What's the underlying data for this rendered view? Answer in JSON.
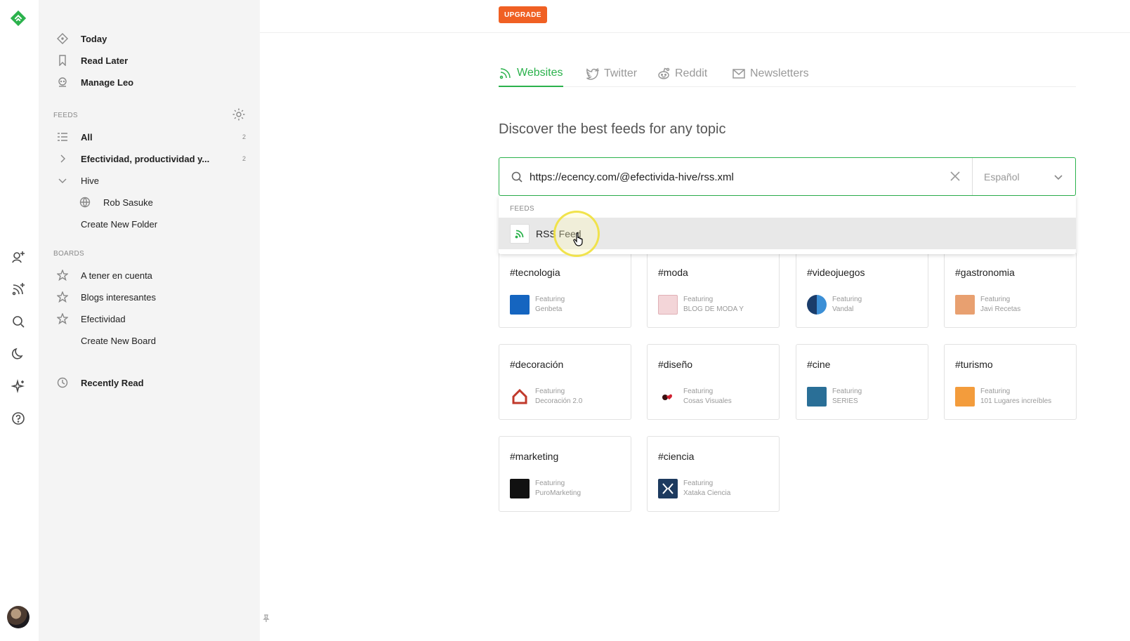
{
  "rail": {
    "icons": [
      "feedly-logo-icon",
      "add-person-icon",
      "add-feed-icon",
      "search-icon",
      "moon-icon",
      "sparkle-icon",
      "help-icon"
    ]
  },
  "sidebar": {
    "primary": [
      {
        "label": "Today",
        "icon": "today-icon"
      },
      {
        "label": "Read Later",
        "icon": "bookmark-icon"
      },
      {
        "label": "Manage Leo",
        "icon": "leo-icon"
      }
    ],
    "feeds_label": "FEEDS",
    "feeds": [
      {
        "label": "All",
        "count": "2"
      },
      {
        "label": "Efectividad, productividad y...",
        "count": "2"
      },
      {
        "label": "Hive"
      },
      {
        "label": "Rob Sasuke"
      },
      {
        "label": "Create New Folder"
      }
    ],
    "boards_label": "BOARDS",
    "boards": [
      {
        "label": "A tener en cuenta"
      },
      {
        "label": "Blogs interesantes"
      },
      {
        "label": "Efectividad"
      },
      {
        "label": "Create New Board"
      }
    ],
    "recently_read": "Recently Read"
  },
  "topbar": {
    "upgrade": "UPGRADE"
  },
  "tabs": [
    {
      "label": "Websites",
      "active": true
    },
    {
      "label": "Twitter",
      "active": false
    },
    {
      "label": "Reddit",
      "active": false
    },
    {
      "label": "Newsletters",
      "active": false
    }
  ],
  "headline": "Discover the best feeds for any topic",
  "search": {
    "value": "https://ecency.com/@efectivida-hive/rss.xml",
    "language": "Español"
  },
  "dropdown": {
    "section": "FEEDS",
    "item": "RSS Feed"
  },
  "topics": [
    {
      "tag": "#tecnologia",
      "featuring": "Featuring",
      "source": "Genbeta",
      "color": "#1565c0"
    },
    {
      "tag": "#moda",
      "featuring": "Featuring",
      "source": "BLOG DE MODA Y",
      "color": "#f3d5d8"
    },
    {
      "tag": "#videojuegos",
      "featuring": "Featuring",
      "source": "Vandal",
      "color": "#1a3d6b"
    },
    {
      "tag": "#gastronomia",
      "featuring": "Featuring",
      "source": "Javi Recetas",
      "color": "#e8a070"
    },
    {
      "tag": "#decoración",
      "featuring": "Featuring",
      "source": "Decoración 2.0",
      "color": "#c0392b"
    },
    {
      "tag": "#diseño",
      "featuring": "Featuring",
      "source": "Cosas Visuales",
      "color": "#3a1010"
    },
    {
      "tag": "#cine",
      "featuring": "Featuring",
      "source": "SERIES",
      "color": "#2a6f97"
    },
    {
      "tag": "#turismo",
      "featuring": "Featuring",
      "source": "101 Lugares increíbles",
      "color": "#f39c3c"
    },
    {
      "tag": "#marketing",
      "featuring": "Featuring",
      "source": "PuroMarketing",
      "color": "#111111"
    },
    {
      "tag": "#ciencia",
      "featuring": "Featuring",
      "source": "Xataka Ciencia",
      "color": "#1d3a5f"
    }
  ],
  "colors": {
    "accent": "#2bb24c",
    "upgrade": "#f06023",
    "sidebar_bg": "#f4f4f4"
  }
}
